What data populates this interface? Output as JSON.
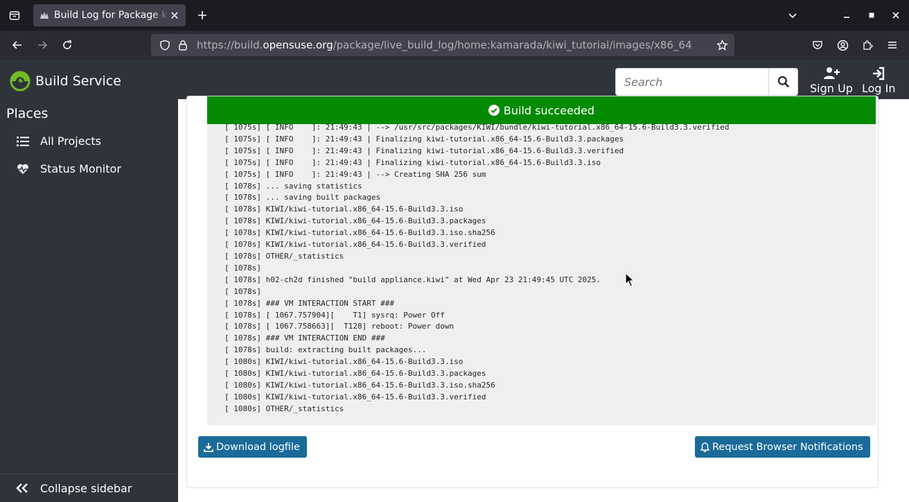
{
  "browser": {
    "tab": {
      "title": "Build Log for Package kiwi"
    },
    "url": {
      "prefix": "https://build.",
      "domain": "opensuse.org",
      "path": "/package/live_build_log/home:kamarada/kiwi_tutorial/images/x86_64"
    }
  },
  "header": {
    "brand": "Build Service",
    "search_placeholder": "Search",
    "sign_up": "Sign Up",
    "log_in": "Log In"
  },
  "sidebar": {
    "heading": "Places",
    "items": [
      {
        "label": "All Projects",
        "icon": "list-icon"
      },
      {
        "label": "Status Monitor",
        "icon": "heartbeat-icon"
      }
    ],
    "collapse": "Collapse sidebar"
  },
  "main": {
    "status": "Build succeeded",
    "status_color": "#038a02",
    "log_lines": [
      "[ 1075s] [ INFO    ]: 21:49:43 | --> /usr/src/packages/KIWI/bundle/kiwi-tutorial.x86_64-15.6-Build3.3.verified",
      "[ 1075s] [ INFO    ]: 21:49:43 | Finalizing kiwi-tutorial.x86_64-15.6-Build3.3.packages",
      "[ 1075s] [ INFO    ]: 21:49:43 | Finalizing kiwi-tutorial.x86_64-15.6-Build3.3.verified",
      "[ 1075s] [ INFO    ]: 21:49:43 | Finalizing kiwi-tutorial.x86_64-15.6-Build3.3.iso",
      "[ 1075s] [ INFO    ]: 21:49:43 | --> Creating SHA 256 sum",
      "[ 1078s] ... saving statistics",
      "[ 1078s] ... saving built packages",
      "[ 1078s] KIWI/kiwi-tutorial.x86_64-15.6-Build3.3.iso",
      "[ 1078s] KIWI/kiwi-tutorial.x86_64-15.6-Build3.3.packages",
      "[ 1078s] KIWI/kiwi-tutorial.x86_64-15.6-Build3.3.iso.sha256",
      "[ 1078s] KIWI/kiwi-tutorial.x86_64-15.6-Build3.3.verified",
      "[ 1078s] OTHER/_statistics",
      "[ 1078s]",
      "[ 1078s] h02-ch2d finished \"build appliance.kiwi\" at Wed Apr 23 21:49:45 UTC 2025.",
      "[ 1078s]",
      "[ 1078s] ### VM INTERACTION START ###",
      "[ 1078s] [ 1067.757904][    T1] sysrq: Power Off",
      "[ 1078s] [ 1067.758663][  T128] reboot: Power down",
      "[ 1078s] ### VM INTERACTION END ###",
      "[ 1078s] build: extracting built packages...",
      "[ 1080s] KIWI/kiwi-tutorial.x86_64-15.6-Build3.3.iso",
      "[ 1080s] KIWI/kiwi-tutorial.x86_64-15.6-Build3.3.packages",
      "[ 1080s] KIWI/kiwi-tutorial.x86_64-15.6-Build3.3.iso.sha256",
      "[ 1080s] KIWI/kiwi-tutorial.x86_64-15.6-Build3.3.verified",
      "[ 1080s] OTHER/_statistics"
    ],
    "download_label": "Download logfile",
    "notify_label": "Request Browser Notifications",
    "button_color": "#1a6b99"
  }
}
